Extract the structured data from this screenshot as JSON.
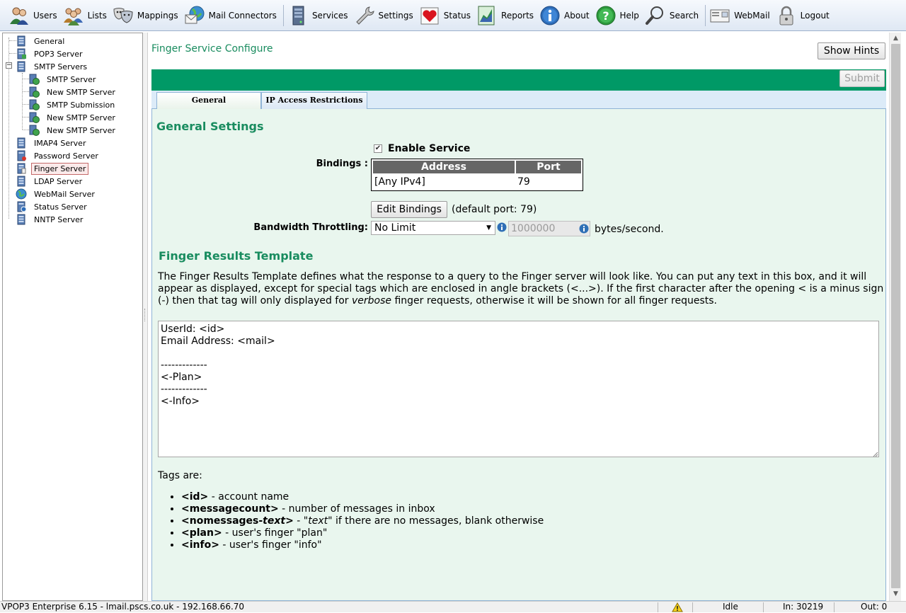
{
  "toolbar": {
    "users": "Users",
    "lists": "Lists",
    "mappings": "Mappings",
    "mail_connectors": "Mail Connectors",
    "services": "Services",
    "settings": "Settings",
    "status": "Status",
    "reports": "Reports",
    "about": "About",
    "help": "Help",
    "search": "Search",
    "webmail": "WebMail",
    "logout": "Logout"
  },
  "tree": {
    "general": "General",
    "pop3": "POP3 Server",
    "smtp_servers": "SMTP Servers",
    "smtp_children": [
      "SMTP Server",
      "New SMTP Server",
      "SMTP Submission",
      "New SMTP Server",
      "New SMTP Server"
    ],
    "imap4": "IMAP4 Server",
    "password": "Password Server",
    "finger": "Finger Server",
    "ldap": "LDAP Server",
    "webmail": "WebMail Server",
    "status": "Status Server",
    "nntp": "NNTP Server",
    "expander": "−"
  },
  "page": {
    "title": "Finger Service Configure",
    "show_hints": "Show Hints",
    "submit": "Submit"
  },
  "tabs": [
    "General",
    "IP Access Restrictions"
  ],
  "general": {
    "heading": "General Settings",
    "enable_label": "Enable Service",
    "checkbox_mark": "✔",
    "bindings_label": "Bindings :",
    "table_headers": [
      "Address",
      "Port"
    ],
    "binding_address": "[Any IPv4]",
    "binding_port": "79",
    "edit_bindings": "Edit Bindings",
    "default_port": "(default port: 79)",
    "throttle_label": "Bandwidth Throttling:",
    "throttle_value": "No Limit",
    "rate_value": "1000000",
    "rate_unit": "bytes/second."
  },
  "template": {
    "heading": "Finger Results Template",
    "desc_1": "The Finger Results Template defines what the response to a query to the Finger server will look like. You can put any text in this box, and it will appear as displayed, except for special tags which are enclosed in angle brackets (<...>). If the first character after the opening < is a minus sign (-) then that tag will only displayed for ",
    "desc_verbose": "verbose",
    "desc_2": " finger requests, otherwise it will be shown for all finger requests.",
    "content": "UserId: <id>\nEmail Address: <mail>\n\n-------------\n<-Plan>\n-------------\n<-Info>",
    "tags_heading": "Tags are:",
    "tags": [
      {
        "tag": "<id>",
        "desc": " - account name"
      },
      {
        "tag": "<messagecount>",
        "desc": " - number of messages in inbox"
      },
      {
        "tag_a": "<nomessages-",
        "tag_b": "text",
        "tag_c": ">",
        "desc_a": " - \"",
        "desc_b": "text",
        "desc_c": "\" if there are no messages, blank otherwise"
      },
      {
        "tag": "<plan>",
        "desc": " - user's finger \"plan\""
      },
      {
        "tag": "<info>",
        "desc": " - user's finger \"info\""
      }
    ]
  },
  "statusbar": {
    "left": "VPOP3 Enterprise 6.15 - lmail.pscs.co.uk - 192.168.66.70",
    "state": "Idle",
    "in": "In: 30219",
    "out": "Out: 0"
  }
}
